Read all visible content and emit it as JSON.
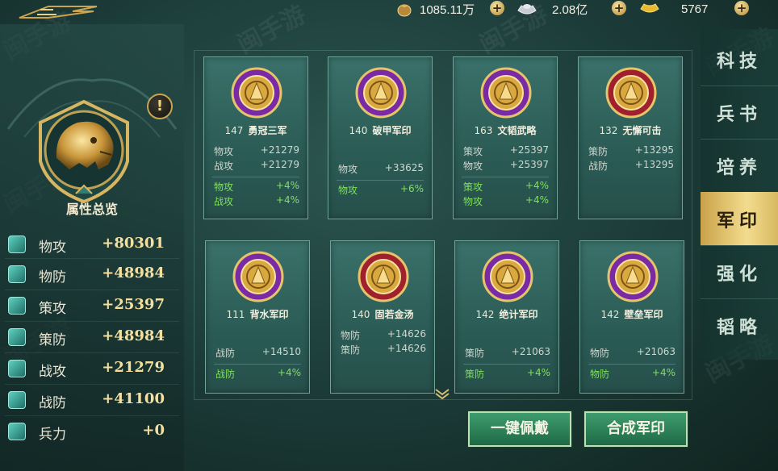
{
  "resources": [
    {
      "icon": "coin-bag-icon",
      "value": "1085.11万"
    },
    {
      "icon": "silver-ingot-icon",
      "value": "2.08亿"
    },
    {
      "icon": "gold-ingot-icon",
      "value": "5767"
    }
  ],
  "left_panel": {
    "title": "属性总览",
    "info_symbol": "!",
    "stats": [
      {
        "icon": "physical-attack-icon",
        "name": "物攻",
        "value": "+80301"
      },
      {
        "icon": "physical-defense-icon",
        "name": "物防",
        "value": "+48984"
      },
      {
        "icon": "strategy-attack-icon",
        "name": "策攻",
        "value": "+25397"
      },
      {
        "icon": "strategy-defense-icon",
        "name": "策防",
        "value": "+48984"
      },
      {
        "icon": "battle-attack-icon",
        "name": "战攻",
        "value": "+21279"
      },
      {
        "icon": "battle-defense-icon",
        "name": "战防",
        "value": "+41100"
      },
      {
        "icon": "troops-icon",
        "name": "兵力",
        "value": "+0"
      }
    ]
  },
  "cards": [
    {
      "level": "147",
      "name": "勇冠三军",
      "icon": "flame-seal-icon",
      "base": [
        {
          "k": "物攻",
          "v": "+21279"
        },
        {
          "k": "战攻",
          "v": "+21279"
        }
      ],
      "bonus": [
        {
          "k": "物攻",
          "v": "+4%"
        },
        {
          "k": "战攻",
          "v": "+4%"
        }
      ]
    },
    {
      "level": "140",
      "name": "破甲军印",
      "icon": "lightning-shield-seal-icon",
      "base": [
        {
          "k": "物攻",
          "v": "+33625"
        }
      ],
      "bonus": [
        {
          "k": "物攻",
          "v": "+6%"
        }
      ]
    },
    {
      "level": "163",
      "name": "文韬武略",
      "icon": "swirl-seal-icon",
      "base": [
        {
          "k": "策攻",
          "v": "+25397"
        },
        {
          "k": "物攻",
          "v": "+25397"
        }
      ],
      "bonus": [
        {
          "k": "策攻",
          "v": "+4%"
        },
        {
          "k": "物攻",
          "v": "+4%"
        }
      ]
    },
    {
      "level": "132",
      "name": "无懈可击",
      "icon": "gem-armor-seal-icon",
      "base": [
        {
          "k": "策防",
          "v": "+13295"
        },
        {
          "k": "战防",
          "v": "+13295"
        }
      ],
      "bonus": []
    },
    {
      "level": "111",
      "name": "背水军印",
      "icon": "arrowhead-seal-icon",
      "base": [
        {
          "k": "战防",
          "v": "+14510"
        }
      ],
      "bonus": [
        {
          "k": "战防",
          "v": "+4%"
        }
      ]
    },
    {
      "level": "140",
      "name": "固若金汤",
      "icon": "hexagram-seal-icon",
      "base": [
        {
          "k": "物防",
          "v": "+14626"
        },
        {
          "k": "策防",
          "v": "+14626"
        }
      ],
      "bonus": []
    },
    {
      "level": "142",
      "name": "绝计军印",
      "icon": "beast-claw-seal-icon",
      "base": [
        {
          "k": "策防",
          "v": "+21063"
        }
      ],
      "bonus": [
        {
          "k": "策防",
          "v": "+4%"
        }
      ]
    },
    {
      "level": "142",
      "name": "壁垒军印",
      "icon": "fortress-wall-seal-icon",
      "base": [
        {
          "k": "物防",
          "v": "+21063"
        }
      ],
      "bonus": [
        {
          "k": "物防",
          "v": "+4%"
        }
      ]
    }
  ],
  "tabs": [
    {
      "label": "科技",
      "active": false
    },
    {
      "label": "兵书",
      "active": false
    },
    {
      "label": "培养",
      "active": false
    },
    {
      "label": "军印",
      "active": true
    },
    {
      "label": "强化",
      "active": false
    },
    {
      "label": "韬略",
      "active": false
    }
  ],
  "buttons": {
    "equip_all": "一键佩戴",
    "synthesize": "合成军印"
  },
  "watermark": {
    "text": "闽手游",
    "url": "laoshouyou.com"
  }
}
